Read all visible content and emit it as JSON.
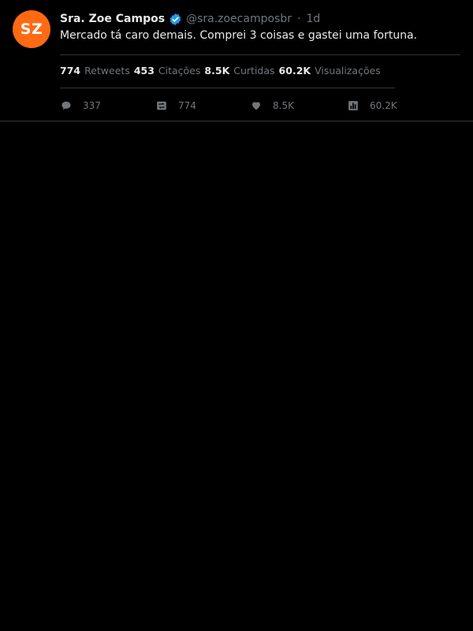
{
  "tweet": {
    "avatar_initials": "SZ",
    "avatar_color": "#ff6a13",
    "display_name": "Sra. Zoe Campos",
    "verified": true,
    "verified_icon": "verified-badge-icon",
    "handle": "@sra.zoecamposbr",
    "separator": "·",
    "time": "1d",
    "text": "Mercado tá caro demais. Comprei 3 coisas e gastei uma fortuna."
  },
  "stats": {
    "retweets_value": "774",
    "retweets_label": "Retweets",
    "quotes_value": "453",
    "quotes_label": "Citações",
    "likes_value": "8.5K",
    "likes_label": "Curtidas",
    "views_value": "60.2K",
    "views_label": "Visualizações"
  },
  "actions": {
    "reply": {
      "icon": "reply-icon",
      "count": "337"
    },
    "retweet": {
      "icon": "retweet-icon",
      "count": "774"
    },
    "like": {
      "icon": "heart-icon",
      "count": "8.5K"
    },
    "views": {
      "icon": "views-icon",
      "count": "60.2K"
    }
  },
  "colors": {
    "background": "#000000",
    "text_primary": "#e7e9ea",
    "text_secondary": "#71767b",
    "divider": "#2f3336",
    "verified_blue": "#1d9bf0"
  }
}
